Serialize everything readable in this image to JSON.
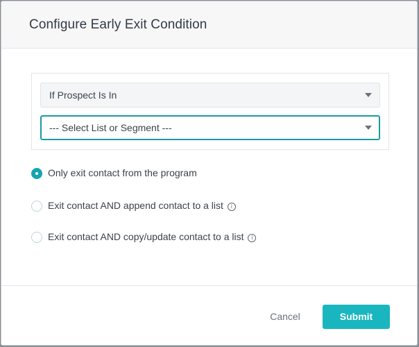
{
  "dialog": {
    "title": "Configure Early Exit Condition"
  },
  "condition": {
    "prospect_select": {
      "value": "If Prospect Is In"
    },
    "list_select": {
      "value": "--- Select List or Segment ---"
    }
  },
  "options": [
    {
      "label": "Only exit contact from the program",
      "checked": true,
      "has_info": false
    },
    {
      "label": "Exit contact AND append contact to a list",
      "checked": false,
      "has_info": true
    },
    {
      "label": "Exit contact AND copy/update contact to a list",
      "checked": false,
      "has_info": true
    }
  ],
  "footer": {
    "cancel_label": "Cancel",
    "submit_label": "Submit"
  },
  "colors": {
    "accent": "#19b6c0",
    "focus_border": "#1a9aa3",
    "text": "#3b4249"
  }
}
